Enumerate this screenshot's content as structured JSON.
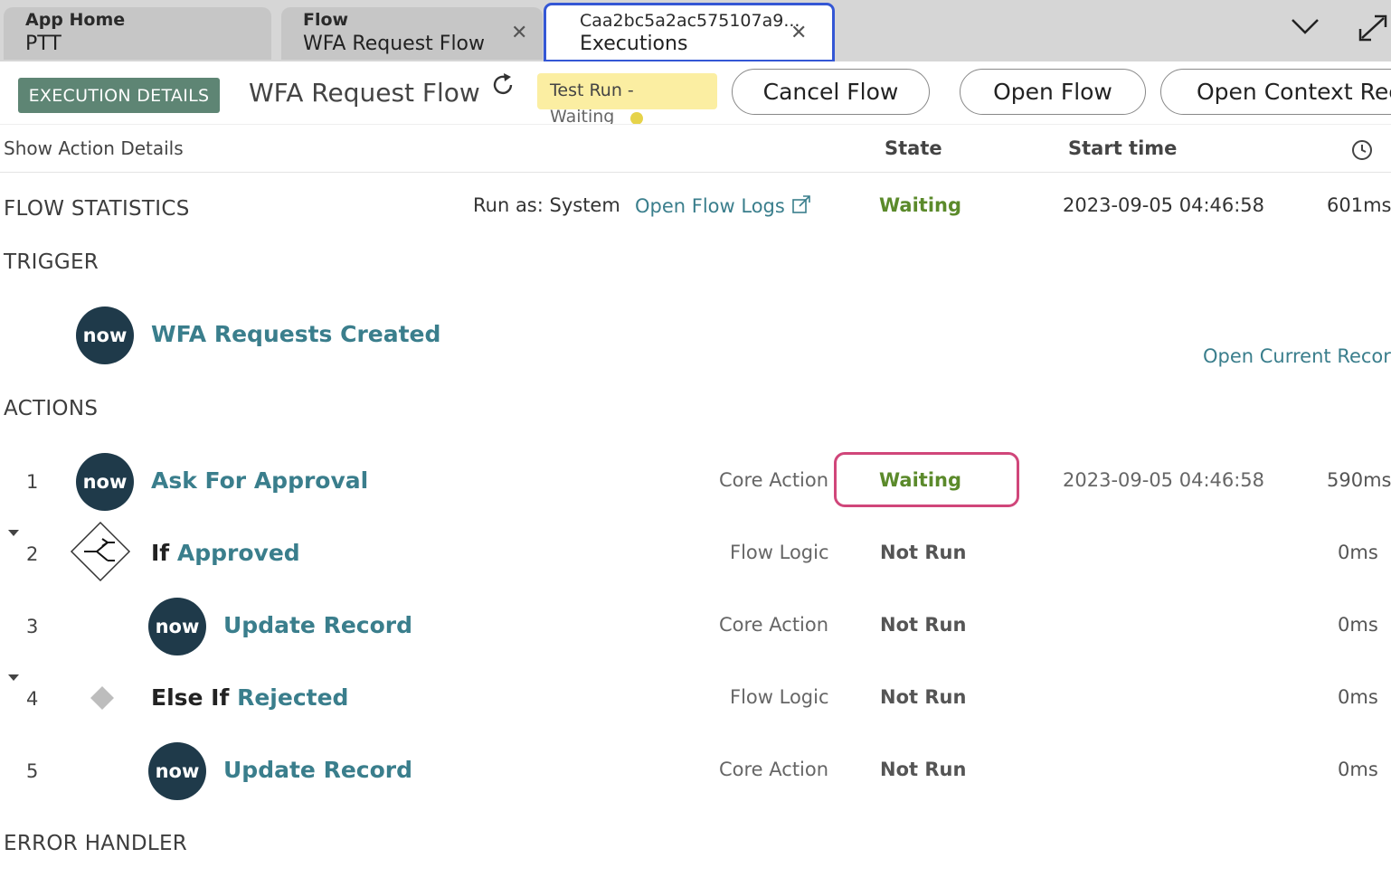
{
  "tabs": [
    {
      "title": "App Home",
      "subtitle": "PTT"
    },
    {
      "title": "Flow",
      "subtitle": "WFA Request Flow"
    },
    {
      "title": "Caa2bc5a2ac575107a9...",
      "subtitle": "Executions"
    }
  ],
  "header": {
    "badge": "EXECUTION DETAILS",
    "flow_name": "WFA Request Flow",
    "status_line1": "Test Run -",
    "status_line2": "Waiting",
    "cancel_flow": "Cancel Flow",
    "open_flow": "Open Flow",
    "open_context": "Open Context Rec"
  },
  "columns": {
    "show_action_details": "Show Action Details",
    "state": "State",
    "start_time": "Start time"
  },
  "flow_statistics": {
    "label": "FLOW STATISTICS",
    "run_as": "Run as: System",
    "open_logs": "Open Flow Logs",
    "state": "Waiting",
    "start_time": "2023-09-05 04:46:58",
    "duration": "601ms"
  },
  "trigger": {
    "label": "TRIGGER",
    "name": "WFA Requests Created",
    "open_record": "Open Current Record"
  },
  "actions_label": "ACTIONS",
  "actions": [
    {
      "num": "1",
      "prefix": "",
      "name": "Ask For Approval",
      "type": "Core Action",
      "state": "Waiting",
      "start": "2023-09-05 04:46:58",
      "duration": "590ms"
    },
    {
      "num": "2",
      "prefix": "If",
      "name": "Approved",
      "type": "Flow Logic",
      "state": "Not Run",
      "start": "",
      "duration": "0ms"
    },
    {
      "num": "3",
      "prefix": "",
      "name": "Update Record",
      "type": "Core Action",
      "state": "Not Run",
      "start": "",
      "duration": "0ms"
    },
    {
      "num": "4",
      "prefix": "Else If",
      "name": "Rejected",
      "type": "Flow Logic",
      "state": "Not Run",
      "start": "",
      "duration": "0ms"
    },
    {
      "num": "5",
      "prefix": "",
      "name": "Update Record",
      "type": "Core Action",
      "state": "Not Run",
      "start": "",
      "duration": "0ms"
    }
  ],
  "error_handler_label": "ERROR HANDLER",
  "logo_text": "now",
  "colors": {
    "accent": "#3a7e8c",
    "waiting": "#5b8a2b",
    "badge": "#5e8574",
    "highlight": "#d0467a",
    "active_tab": "#3457d5"
  }
}
